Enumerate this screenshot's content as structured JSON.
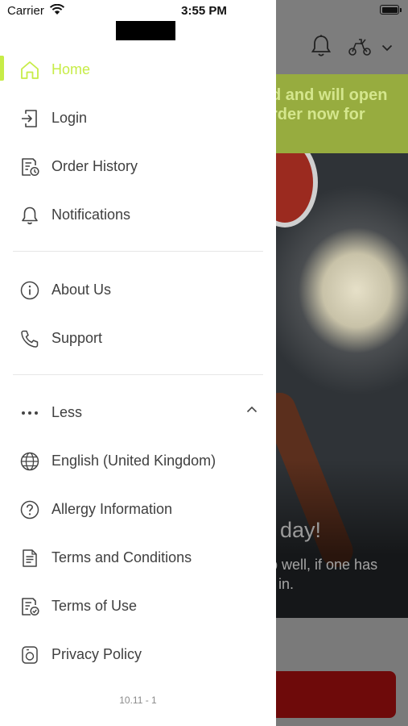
{
  "status_bar": {
    "carrier": "Carrier",
    "time": "3:55 PM"
  },
  "drawer": {
    "items": [
      {
        "label": "Home",
        "icon": "home-icon",
        "active": true
      },
      {
        "label": "Login",
        "icon": "login-icon"
      },
      {
        "label": "Order History",
        "icon": "order-history-icon"
      },
      {
        "label": "Notifications",
        "icon": "bell-icon"
      },
      {
        "label": "About Us",
        "icon": "info-icon"
      },
      {
        "label": "Support",
        "icon": "phone-icon"
      },
      {
        "label": "Less",
        "icon": "more-dots-icon"
      },
      {
        "label": "English (United Kingdom)",
        "icon": "globe-icon"
      },
      {
        "label": "Allergy Information",
        "icon": "question-icon"
      },
      {
        "label": "Terms and Conditions",
        "icon": "document-icon"
      },
      {
        "label": "Terms of Use",
        "icon": "document-check-icon"
      },
      {
        "label": "Privacy Policy",
        "icon": "privacy-icon"
      }
    ],
    "version": "10.11 - 1",
    "accent_color": "#c7ec47"
  },
  "background_app": {
    "banner_line1": "d and will open",
    "banner_line2": "rder now for",
    "hero_title": "day!",
    "hero_line1": "p well, if one has",
    "hero_line2": "r in."
  }
}
